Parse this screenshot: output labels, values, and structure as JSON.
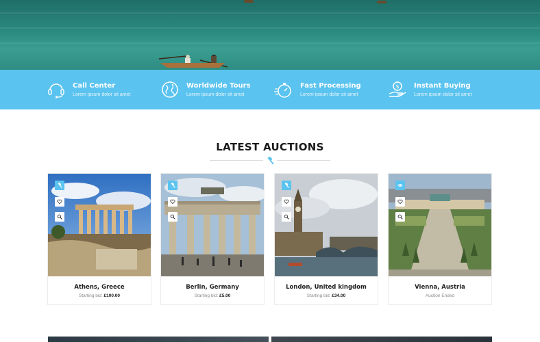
{
  "features": [
    {
      "title": "Call Center",
      "desc": "Lorem ipsum dolor sit amet",
      "icon": "headset-icon"
    },
    {
      "title": "Worldwide Tours",
      "desc": "Lorem ipsum dolor sit amet",
      "icon": "globe-icon"
    },
    {
      "title": "Fast Processing",
      "desc": "Lorem ipsum dolor sit amet",
      "icon": "stopwatch-icon"
    },
    {
      "title": "Instant Buying",
      "desc": "Lorem ipsum dolor sit amet",
      "icon": "money-hand-icon"
    }
  ],
  "section": {
    "title": "LATEST AUCTIONS"
  },
  "auctions": [
    {
      "name": "Athens, Greece",
      "bid_label": "Starting bid:",
      "bid_value": "£100.00"
    },
    {
      "name": "Berlin, Germany",
      "bid_label": "Starting bid:",
      "bid_value": "£5.00"
    },
    {
      "name": "London, United kingdom",
      "bid_label": "Starting bid:",
      "bid_value": "£34.00"
    },
    {
      "name": "Vienna, Austria",
      "bid_label": "Auction Ended",
      "bid_value": ""
    }
  ],
  "colors": {
    "accent": "#5bc3ef",
    "hero": "#2a8a80"
  }
}
